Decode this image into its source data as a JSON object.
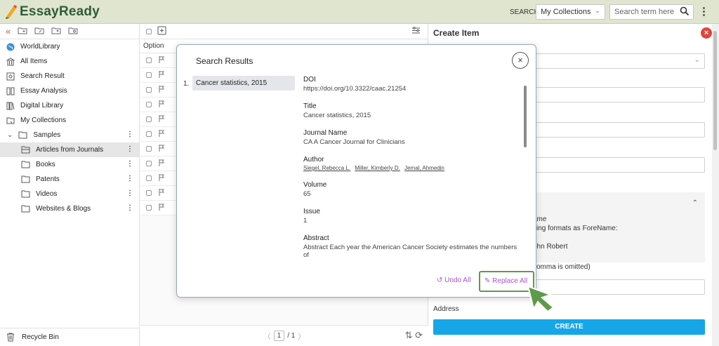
{
  "header": {
    "app_name": "EssayReady",
    "search_label": "SEARCH",
    "collection_select": "My Collections",
    "search_placeholder": "Search term here"
  },
  "sidebar": {
    "items": [
      {
        "label": "WorldLibrary",
        "icon": "globe-icon"
      },
      {
        "label": "All Items",
        "icon": "bank-icon"
      },
      {
        "label": "Search Result",
        "icon": "search-result-icon"
      },
      {
        "label": "Essay Analysis",
        "icon": "analysis-icon"
      },
      {
        "label": "Digital Library",
        "icon": "library-icon"
      },
      {
        "label": "My Collections",
        "icon": "collections-icon"
      }
    ],
    "samples_label": "Samples",
    "folders": [
      "Articles from Journals",
      "Books",
      "Patents",
      "Videos",
      "Websites & Blogs"
    ],
    "recycle_bin": "Recycle Bin"
  },
  "list": {
    "header": "Option",
    "row_count": 11,
    "page_current": "1",
    "page_total": "/ 1"
  },
  "right_panel": {
    "title": "Create Item",
    "author_lines": [
      "ame",
      "ving formats as ForeName:",
      "ohn Robert",
      "comma is omitted)"
    ],
    "address_label": "Address",
    "create_button": "CREATE"
  },
  "modal": {
    "title": "Search Results",
    "result_index": "1.",
    "result_title": "Cancer statistics, 2015",
    "fields": [
      {
        "label": "DOI",
        "value": "https://doi.org/10.3322/caac.21254"
      },
      {
        "label": "Title",
        "value": "Cancer statistics, 2015"
      },
      {
        "label": "Journal Name",
        "value": "CA A Cancer Journal for Clinicians"
      }
    ],
    "author_label": "Author",
    "authors": [
      "Siegel, Rebecca L.",
      "Miller, Kimberly D.",
      "Jemal, Ahmedin"
    ],
    "fields2": [
      {
        "label": "Volume",
        "value": "65"
      },
      {
        "label": "Issue",
        "value": "1"
      },
      {
        "label": "Abstract",
        "value": "Abstract Each year the American Cancer Society estimates the numbers of"
      }
    ],
    "undo_all": "Undo All",
    "replace_all": "Replace All"
  },
  "colors": {
    "topbar_bg": "#dfe5cf",
    "accent_purple": "#a855d4",
    "create_blue": "#16a6e8",
    "highlight_green": "#5e9a4a",
    "close_red": "#e2453a"
  }
}
